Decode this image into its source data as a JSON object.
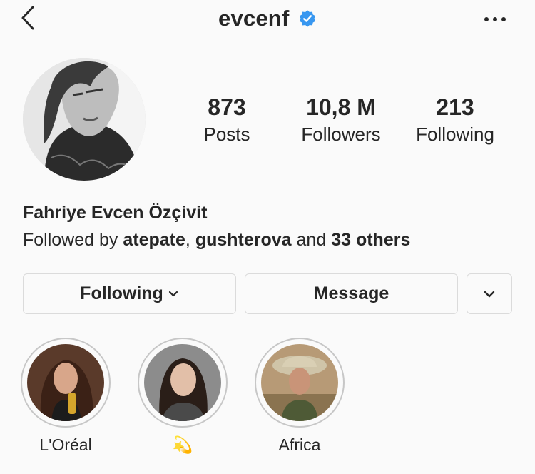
{
  "header": {
    "username": "evcenf",
    "back_icon": "chevron-left-icon",
    "verified_icon": "verified-badge-icon",
    "more_icon": "more-horizontal-icon"
  },
  "stats": [
    {
      "value": "873",
      "label": "Posts"
    },
    {
      "value": "10,8 M",
      "label": "Followers"
    },
    {
      "value": "213",
      "label": "Following"
    }
  ],
  "bio": {
    "full_name": "Fahriye Evcen Özçivit",
    "followed_by_prefix": "Followed by",
    "followed_by_user1": "atepate",
    "followed_by_sep": ",",
    "followed_by_user2": "gushterova",
    "followed_by_and": "and",
    "followed_by_others": "33 others"
  },
  "actions": {
    "following_label": "Following",
    "message_label": "Message"
  },
  "highlights": [
    {
      "label": "L'Oréal"
    },
    {
      "label": "💫"
    },
    {
      "label": "Africa"
    }
  ],
  "colors": {
    "text": "#262626",
    "verified_blue": "#3897f0",
    "border": "#dbdbdb",
    "background": "#fafafa"
  }
}
